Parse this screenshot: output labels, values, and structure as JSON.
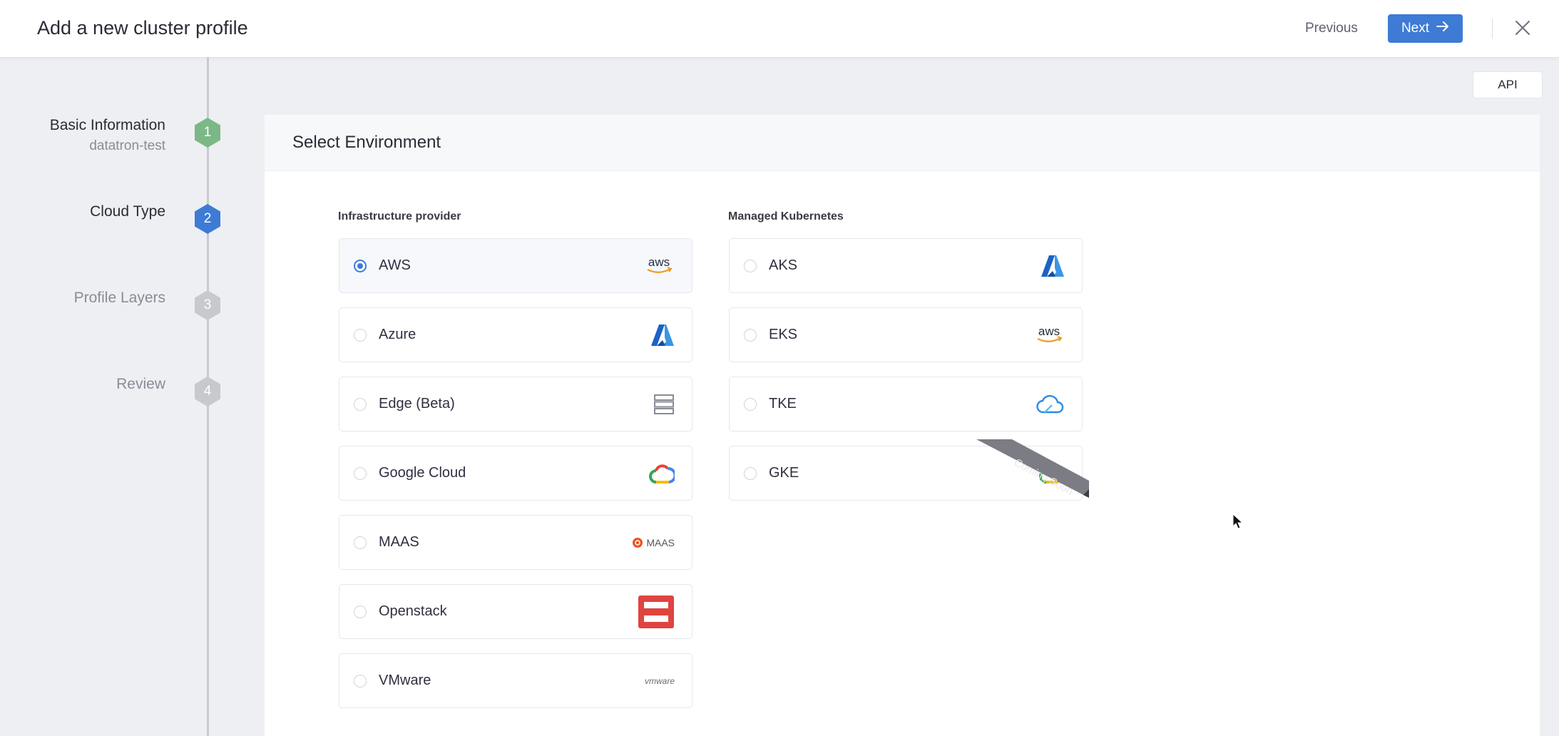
{
  "header": {
    "title": "Add a new cluster profile",
    "previous_label": "Previous",
    "next_label": "Next"
  },
  "stepper": {
    "steps": [
      {
        "label": "Basic Information",
        "sub": "datatron-test",
        "number": "1",
        "state": "done",
        "color": "#7cb887"
      },
      {
        "label": "Cloud Type",
        "number": "2",
        "state": "active",
        "color": "#3d7bd5"
      },
      {
        "label": "Profile Layers",
        "number": "3",
        "state": "pending",
        "color": "#c8c9cf"
      },
      {
        "label": "Review",
        "number": "4",
        "state": "pending",
        "color": "#c8c9cf"
      }
    ]
  },
  "api_label": "API",
  "main": {
    "title": "Select Environment",
    "infrastructure": {
      "label": "Infrastructure provider",
      "options": [
        {
          "label": "AWS",
          "icon": "aws-logo",
          "selected": true
        },
        {
          "label": "Azure",
          "icon": "azure-logo"
        },
        {
          "label": "Edge (Beta)",
          "icon": "edge-server-icon"
        },
        {
          "label": "Google Cloud",
          "icon": "google-cloud-logo"
        },
        {
          "label": "MAAS",
          "icon": "maas-logo",
          "icon_text": "MAAS"
        },
        {
          "label": "Openstack",
          "icon": "openstack-logo"
        },
        {
          "label": "VMware",
          "icon": "vmware-logo",
          "icon_text": "vmware"
        }
      ]
    },
    "managed": {
      "label": "Managed Kubernetes",
      "options": [
        {
          "label": "AKS",
          "icon": "azure-logo"
        },
        {
          "label": "EKS",
          "icon": "aws-logo"
        },
        {
          "label": "TKE",
          "icon": "tencent-cloud-logo"
        },
        {
          "label": "GKE",
          "icon": "google-cloud-logo",
          "badge": "Coming Soon"
        }
      ]
    }
  },
  "colors": {
    "accent": "#3d7bd5",
    "done": "#7cb887",
    "pending": "#c8c9cf"
  }
}
